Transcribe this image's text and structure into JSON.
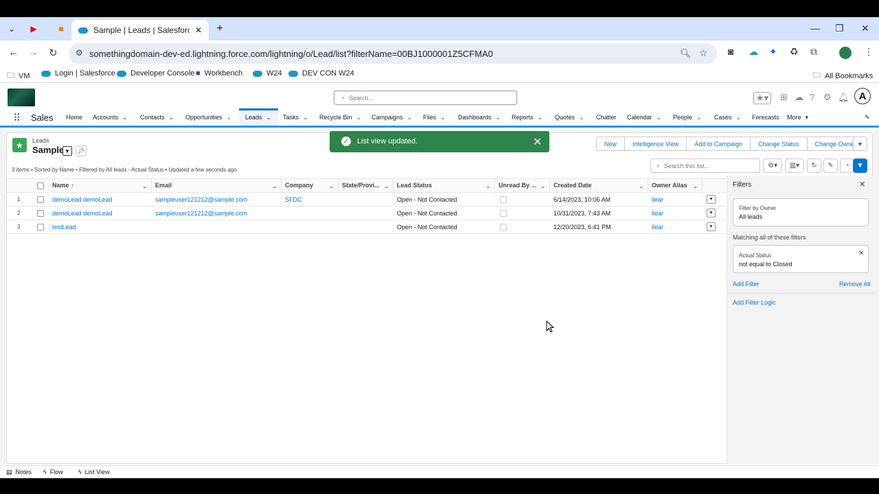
{
  "browser": {
    "tab_title": "Sample | Leads | Salesforce",
    "url": "somethingdomain-dev-ed.lightning.force.com/lightning/o/Lead/list?filterName=00BJ1000001Z5CFMA0",
    "bookmarks": [
      "VM",
      "Login | Salesforce",
      "Developer Console",
      "Workbench",
      "W24",
      "DEV CON W24"
    ],
    "all_bookmarks": "All Bookmarks"
  },
  "header": {
    "search_placeholder": "Search...",
    "app_name": "Sales",
    "avatar_letter": "A"
  },
  "nav": {
    "items": [
      "Home",
      "Accounts",
      "Contacts",
      "Opportunities",
      "Leads",
      "Tasks",
      "Recycle Bin",
      "Campaigns",
      "Files",
      "Dashboards",
      "Reports",
      "Quotes",
      "Chatter",
      "Calendar",
      "People",
      "Cases",
      "Forecasts",
      "More"
    ]
  },
  "list": {
    "object_label": "Leads",
    "view_name": "Sample",
    "meta": "3 items • Sorted by Name • Filtered by All leads - Actual Status • Updated a few seconds ago",
    "buttons": [
      "New",
      "Intelligence View",
      "Add to Campaign",
      "Change Status",
      "Change Owner"
    ],
    "search_placeholder": "Search this list...",
    "columns": [
      "Name ↑",
      "Email",
      "Company",
      "State/Provi...",
      "Lead Status",
      "Unread By ...",
      "Created Date",
      "Owner Alias"
    ],
    "rows": [
      {
        "num": "1",
        "name": "demoLead demoLead",
        "email": "sampleuser121212@sample.com",
        "company": "SFDC",
        "state": "",
        "status": "Open - Not Contacted",
        "created": "6/14/2023, 10:06 AM",
        "owner": "llear"
      },
      {
        "num": "2",
        "name": "demoLead demoLead",
        "email": "sampleuser121212@sample.com",
        "company": "",
        "state": "",
        "status": "Open - Not Contacted",
        "created": "10/31/2023, 7:43 AM",
        "owner": "llear"
      },
      {
        "num": "3",
        "name": "testLead",
        "email": "",
        "company": "",
        "state": "",
        "status": "Open - Not Contacted",
        "created": "12/20/2023, 6:41 PM",
        "owner": "llear"
      }
    ]
  },
  "filters": {
    "title": "Filters",
    "owner_label": "Filter by Owner",
    "owner_value": "All leads",
    "matching": "Matching all of these filters",
    "filter1_label": "Actual Status",
    "filter1_value": "not equal to  Closed",
    "add_filter": "Add Filter",
    "remove_all": "Remove All",
    "add_logic": "Add Filter Logic"
  },
  "toast": {
    "message": "List view updated."
  },
  "utility": [
    "Notes",
    "Flow",
    "List View"
  ],
  "colors": {
    "brand": "#0176d3",
    "toast": "#2e844a",
    "leads_icon": "#3ba755"
  }
}
